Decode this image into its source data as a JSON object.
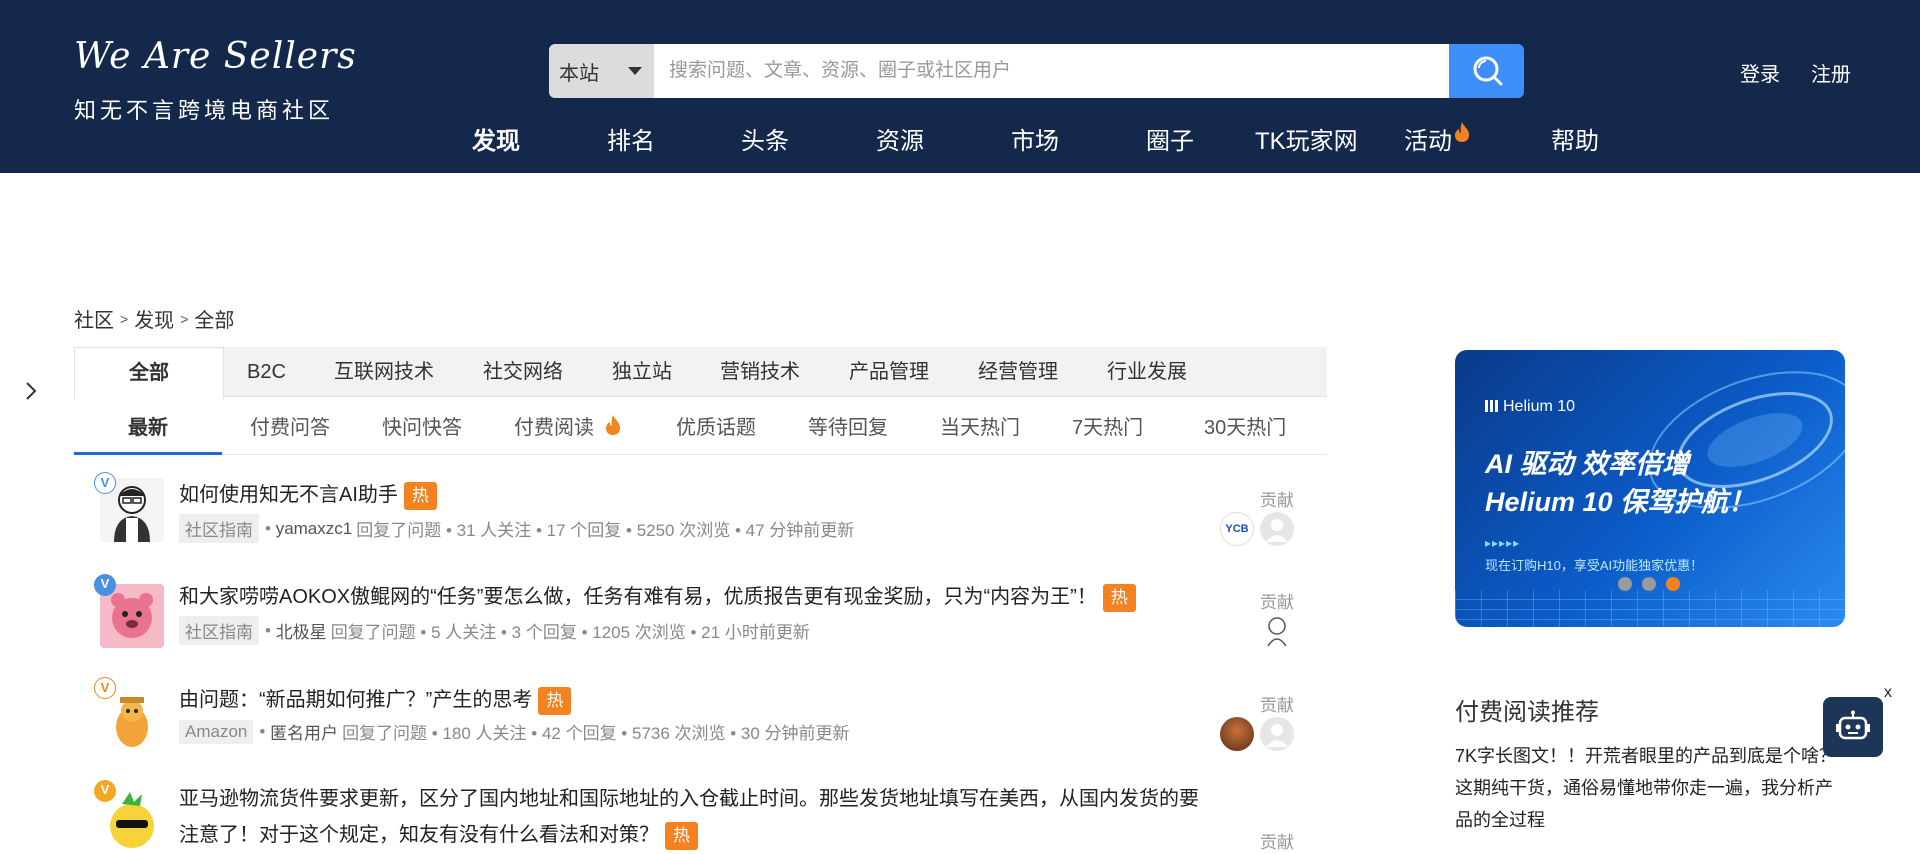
{
  "header": {
    "logo_en": "We Are Sellers",
    "logo_cn": "知无不言跨境电商社区",
    "search_scope": "本站",
    "search_placeholder": "搜索问题、文章、资源、圈子或社区用户",
    "login": "登录",
    "register": "注册",
    "nav": [
      "发现",
      "排名",
      "头条",
      "资源",
      "市场",
      "圈子",
      "TK玩家网",
      "活动",
      "帮助"
    ]
  },
  "breadcrumb": [
    "社区",
    "发现",
    "全部"
  ],
  "categories": [
    "全部",
    "B2C",
    "互联网技术",
    "社交网络",
    "独立站",
    "营销技术",
    "产品管理",
    "经营管理",
    "行业发展"
  ],
  "subtabs": [
    "最新",
    "付费问答",
    "快问快答",
    "付费阅读",
    "优质话题",
    "等待回复",
    "当天热门",
    "7天热门",
    "30天热门"
  ],
  "hot_label": "热",
  "contrib_label": "贡献",
  "questions": [
    {
      "title": "如何使用知无不言AI助手",
      "tag": "社区指南",
      "user": "yamaxzc1",
      "action": "回复了问题",
      "stats": "• 31 人关注 • 17 个回复 • 5250 次浏览 • 47 分钟前更新"
    },
    {
      "title": "和大家唠唠AOKOX傲鲲网的“任务”要怎么做，任务有难有易，优质报告更有现金奖励，只为“内容为王”！",
      "tag": "社区指南",
      "user": "北极星",
      "action": "回复了问题",
      "stats": "• 5 人关注 • 3 个回复 • 1205 次浏览 • 21 小时前更新"
    },
    {
      "title": "由问题：“新品期如何推广？”产生的思考",
      "tag": "Amazon",
      "user": "匿名用户",
      "action": "回复了问题",
      "stats": "• 180 人关注 • 42 个回复 • 5736 次浏览 • 30 分钟前更新"
    },
    {
      "title_line1": "亚马逊物流货件要求更新，区分了国内地址和国际地址的入仓截止时间。那些发货地址填写在美西，从国内发货的要",
      "title_line2": "注意了！对于这个规定，知友有没有什么看法和对策？"
    }
  ],
  "ad": {
    "brand": "Helium 10",
    "headline1": "AI 驱动  效率倍增",
    "headline2": "Helium 10 保驾护航！",
    "sub": "现在订购H10，享受AI功能独家优惠！"
  },
  "recommend": {
    "title": "付费阅读推荐",
    "text": "7K字长图文！！开荒者眼里的产品到底是个啥？这期纯干货，通俗易懂地带你走一遍，我分析产品的全过程"
  },
  "robot_close": "x",
  "colors": {
    "header_bg": "#13284a",
    "search_btn": "#3d8ef7",
    "hot": "#f58220",
    "active_tab": "#1b6cd5"
  }
}
